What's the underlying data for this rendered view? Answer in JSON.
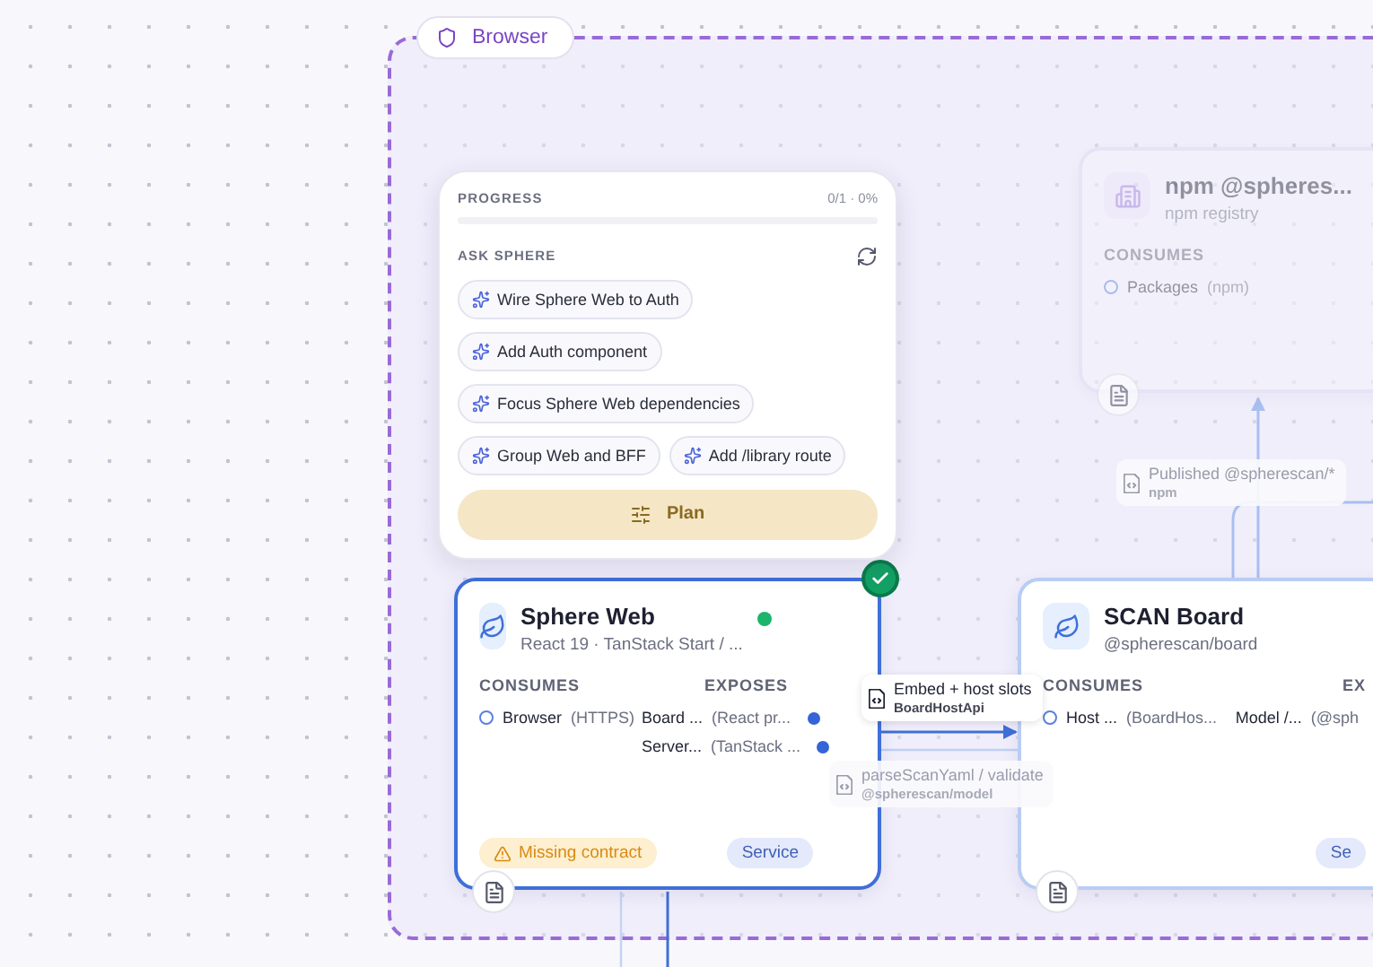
{
  "group": {
    "label": "Browser"
  },
  "progress_panel": {
    "title": "PROGRESS",
    "count": "0/1 · 0%",
    "level": 0,
    "section_title": "ASK SPHERE",
    "suggestions": [
      "Wire Sphere Web to Auth",
      "Add Auth component",
      "Focus Sphere Web dependencies",
      "Group Web and BFF",
      "Add /library route"
    ],
    "plan_button": "Plan"
  },
  "nodes": [
    {
      "kind": "registry",
      "title": "npm @spheres...",
      "subtitle": "npm registry",
      "dimmed": true,
      "selected": false,
      "consumes_label": "CONSUMES",
      "consumes": [
        {
          "name": "Packages",
          "detail": "(npm)"
        }
      ]
    },
    {
      "kind": "service",
      "title": "Sphere Web",
      "subtitle": "React 19 · TanStack Start / ...",
      "dimmed": false,
      "online": true,
      "checked": true,
      "selected": true,
      "consumes_label": "CONSUMES",
      "exposes_label": "EXPOSES",
      "consumes": [
        {
          "name": "Browser",
          "detail": "(HTTPS)"
        }
      ],
      "exposes": [
        {
          "name": "Board ...",
          "detail": "(React pr..."
        },
        {
          "name": "Server...",
          "detail": "(TanStack ..."
        }
      ],
      "warning": "Missing contract",
      "tag": "Service"
    },
    {
      "kind": "service",
      "title": "SCAN Board",
      "subtitle": "@spherescan/board",
      "dimmed": false,
      "selected": false,
      "consumes_label": "CONSUMES",
      "exposes_label": "EX",
      "consumes": [
        {
          "name": "Host ...",
          "detail": "(BoardHos..."
        }
      ],
      "exposes": [
        {
          "name": "Model /...",
          "detail": "(@sph"
        }
      ],
      "tag": "Se"
    }
  ],
  "edge_labels": [
    {
      "title": "Published @spherescan/*",
      "subtitle": "npm",
      "dimmed": true
    },
    {
      "title": "Embed + host slots",
      "subtitle": "BoardHostApi",
      "dimmed": false
    },
    {
      "title": "parseScanYaml / validate",
      "subtitle": "@spherescan/model",
      "dimmed": true
    }
  ]
}
